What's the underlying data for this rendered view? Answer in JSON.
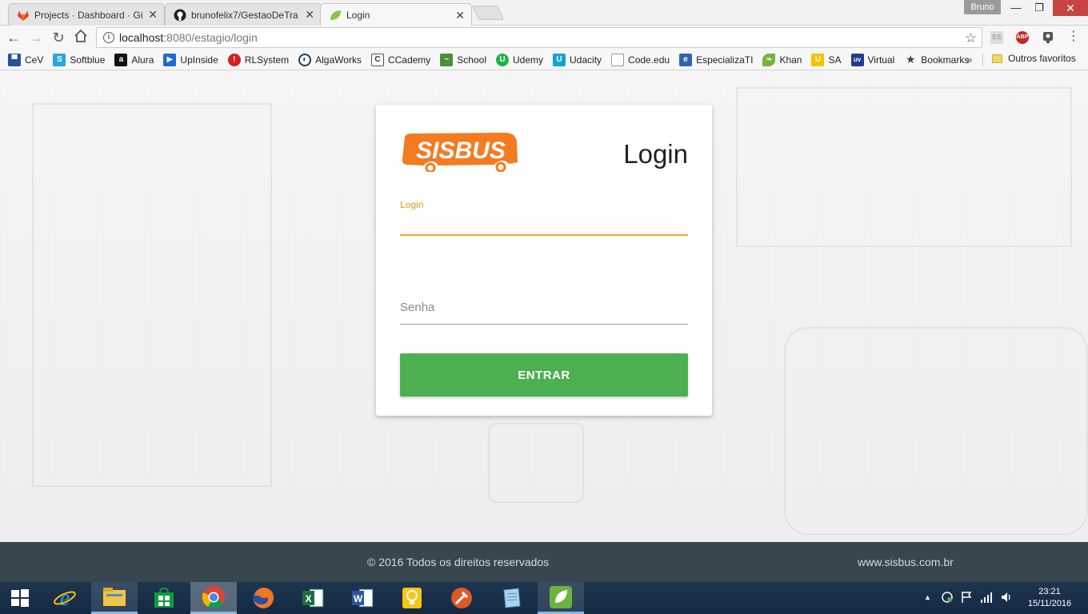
{
  "browser": {
    "tabs": [
      {
        "title": "Projects · Dashboard · Git",
        "icon": "gitlab-icon"
      },
      {
        "title": "brunofelix7/GestaoDeTra",
        "icon": "github-icon"
      },
      {
        "title": "Login",
        "icon": "spring-leaf-icon"
      }
    ],
    "user": "Bruno",
    "address": {
      "host": "localhost",
      "path": ":8080/estagio/login"
    },
    "bookmarks": [
      {
        "label": "CeV",
        "icon": "cev-icon",
        "color": "#2b4f9e"
      },
      {
        "label": "Softblue",
        "icon": "softblue-icon",
        "color": "#29a7df"
      },
      {
        "label": "Alura",
        "icon": "alura-icon",
        "color": "#111111"
      },
      {
        "label": "UpInside",
        "icon": "upinside-icon",
        "color": "#1e6dd0"
      },
      {
        "label": "RLSystem",
        "icon": "rlsystem-icon",
        "color": "#d91f1f"
      },
      {
        "label": "AlgaWorks",
        "icon": "algaworks-icon",
        "color": "#1c3c5c"
      },
      {
        "label": "CCademy",
        "icon": "ccademy-icon",
        "color": "#555555"
      },
      {
        "label": "School",
        "icon": "school-icon",
        "color": "#4a8f3c"
      },
      {
        "label": "Udemy",
        "icon": "udemy-icon",
        "color": "#1eb34a"
      },
      {
        "label": "Udacity",
        "icon": "udacity-icon",
        "color": "#15a3d6"
      },
      {
        "label": "Code.edu",
        "icon": "page-icon",
        "color": "#999999"
      },
      {
        "label": "EspecializaTI",
        "icon": "especializati-icon",
        "color": "#2f66b3"
      },
      {
        "label": "Khan",
        "icon": "khan-icon",
        "color": "#76b53c"
      },
      {
        "label": "SA",
        "icon": "sa-icon",
        "color": "#f2c300"
      },
      {
        "label": "Virtual",
        "icon": "virtual-icon",
        "color": "#233c8a"
      },
      {
        "label": "Bookmarks",
        "icon": "star-icon",
        "color": "#444444"
      }
    ],
    "more": "»",
    "other_bookmarks": "Outros favoritos"
  },
  "card": {
    "logo_text": "SISBUS",
    "title": "Login",
    "login_label": "Login",
    "login_value": "",
    "password_placeholder": "Senha",
    "submit": "ENTRAR"
  },
  "footer": {
    "copyright": "© 2016 Todos os direitos reservados",
    "site": "www.sisbus.com.br"
  },
  "taskbar": {
    "apps": [
      "internet-explorer-icon",
      "file-explorer-icon",
      "store-icon",
      "chrome-icon",
      "firefox-icon",
      "excel-icon",
      "word-icon",
      "bulb-icon",
      "tool-icon",
      "notepad-icon",
      "spring-icon"
    ],
    "time": "23:21",
    "date": "15/11/2016"
  },
  "colors": {
    "accent": "#f0a830",
    "logo_orange": "#f47b20",
    "button_green": "#4caf50",
    "footer_bg": "#37474f"
  }
}
